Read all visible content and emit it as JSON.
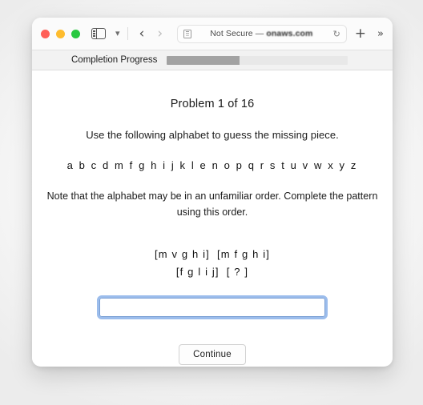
{
  "browser": {
    "traffic_lights": [
      "close",
      "minimize",
      "maximize"
    ],
    "sidebar_icon": "sidebar-icon",
    "tab_overview_icon": "chevron-down-icon",
    "back_icon": "chevron-left-icon",
    "forward_icon": "chevron-right-icon",
    "reader_icon": "reader-view-icon",
    "security_label": "Not Secure —",
    "domain": "onaws.com",
    "reload_icon": "reload-icon",
    "new_tab_icon": "plus-icon",
    "more_icon": "double-chevron-right-icon"
  },
  "progress": {
    "label": "Completion Progress",
    "percent": 40
  },
  "page": {
    "problem_title": "Problem 1 of 16",
    "instruction": "Use the following alphabet to guess the missing piece.",
    "alphabet": "a b c d m f g h i j k l e n o p q r s t u v w x y z",
    "note": "Note that the alphabet may be in an unfamiliar order. Complete the pattern using this order.",
    "pattern_line_1_left": "[m v g h i]",
    "pattern_line_1_right": "[m f g h i]",
    "pattern_line_2_left": "[f g l i j]",
    "pattern_line_2_right": "[ ? ]",
    "answer_value": "",
    "answer_placeholder": "",
    "continue_label": "Continue"
  },
  "colors": {
    "accent_focus": "#76a3e4",
    "progress_fill": "#a2a2a2",
    "progress_track": "#e8e8e8"
  }
}
